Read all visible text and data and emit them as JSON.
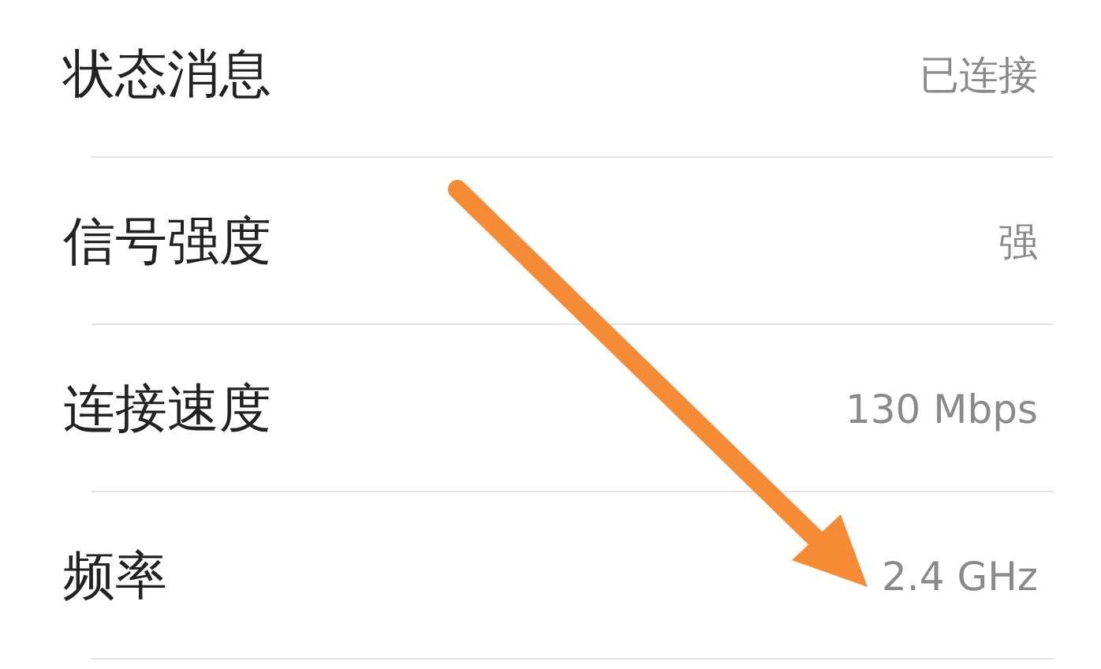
{
  "rows": [
    {
      "label": "状态消息",
      "value": "已连接"
    },
    {
      "label": "信号强度",
      "value": "强"
    },
    {
      "label": "连接速度",
      "value": "130 Mbps"
    },
    {
      "label": "频率",
      "value": "2.4 GHz"
    }
  ]
}
